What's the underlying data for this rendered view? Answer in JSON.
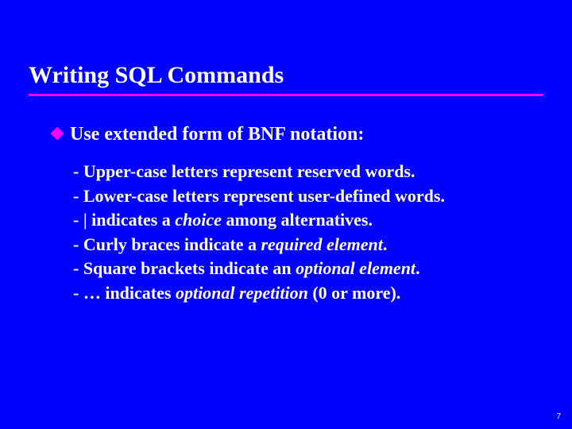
{
  "title": "Writing SQL Commands",
  "main_bullet": {
    "lead": "Use",
    "rest": " extended form of BNF notation:"
  },
  "items": [
    {
      "pre": "- Upper-case letters represent reserved words.",
      "it": "",
      "post": ""
    },
    {
      "pre": "- Lower-case letters represent user-defined words.",
      "it": "",
      "post": ""
    },
    {
      "pre": "- | indicates a ",
      "it": "choice",
      "post": " among alternatives."
    },
    {
      "pre": "- Curly braces indicate a ",
      "it": "required element",
      "post": "."
    },
    {
      "pre": "- Square brackets indicate an ",
      "it": "optional element",
      "post": "."
    },
    {
      "pre": "- … indicates ",
      "it": "optional repetition",
      "post": " (0 or more)."
    }
  ],
  "page_number": "7"
}
